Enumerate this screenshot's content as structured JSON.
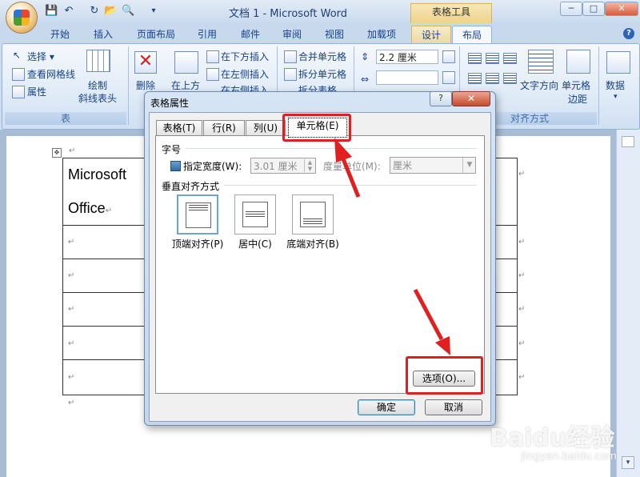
{
  "window": {
    "title": "文档 1 - Microsoft Word",
    "contextual_title": "表格工具",
    "minimize": "─",
    "maximize": "□",
    "close": "✕"
  },
  "ribbon": {
    "tabs": [
      "开始",
      "插入",
      "页面布局",
      "引用",
      "邮件",
      "审阅",
      "视图",
      "加载项",
      "设计",
      "布局"
    ],
    "active_tab": "布局",
    "help": "?",
    "table_group": {
      "label": "表",
      "select": "选择",
      "gridlines": "查看网格线",
      "properties": "属性",
      "draw_diag_1": "绘制",
      "draw_diag_2": "斜线表头"
    },
    "rows_group": {
      "delete": "删除",
      "insert_above": "在上方",
      "insert_below": "在下方插入",
      "insert_left": "在左侧插入",
      "insert_right": "在右侧插入"
    },
    "merge_group": {
      "merge": "合并单元格",
      "split": "拆分单元格",
      "split_table": "拆分表格"
    },
    "size_group": {
      "height": "2.2 厘米"
    },
    "align_group": {
      "label": "对齐方式",
      "text_direction": "文字方向",
      "cell_margins_1": "单元格",
      "cell_margins_2": "边距"
    },
    "data_group": {
      "data": "数据"
    }
  },
  "document": {
    "cell1_line1": "Microsoft",
    "cell1_line2": "Office",
    "para_mark": "↵"
  },
  "dialog": {
    "title": "表格属性",
    "help": "?",
    "close": "✕",
    "tabs": [
      "表格(T)",
      "行(R)",
      "列(U)",
      "单元格(E)"
    ],
    "selected_tab": "单元格(E)",
    "size_section": "字号",
    "preferred_width_label": "指定宽度(W):",
    "preferred_width_checked": true,
    "preferred_width_value": "3.01 厘米",
    "measure_label": "度量单位(M):",
    "measure_value": "厘米",
    "valign_section": "垂直对齐方式",
    "valign_options": [
      "顶端对齐(P)",
      "居中(C)",
      "底端对齐(B)"
    ],
    "valign_selected": "顶端对齐(P)",
    "options_button": "选项(O)...",
    "ok": "确定",
    "cancel": "取消"
  },
  "watermark": {
    "brand": "Baidu经验",
    "url": "jingyan.baidu.com"
  },
  "colors": {
    "annotation_red": "#e02020",
    "ribbon_blue": "#15428b"
  }
}
